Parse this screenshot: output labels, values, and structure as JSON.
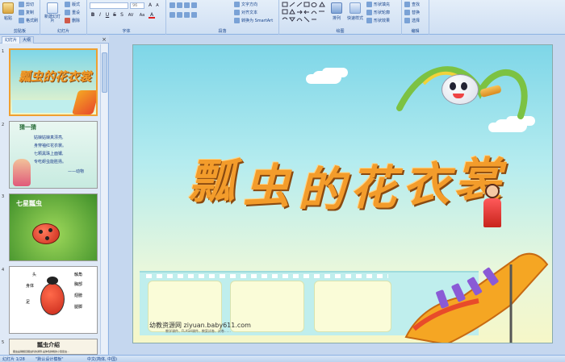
{
  "ribbon": {
    "clipboard": {
      "label": "剪贴板",
      "paste": "粘贴",
      "cut": "剪切",
      "copy": "复制",
      "format_painter": "格式刷"
    },
    "slides": {
      "label": "幻灯片",
      "new_slide": "新建幻灯片",
      "layout": "版式",
      "reset": "重设",
      "delete": "删除"
    },
    "font": {
      "label": "字体",
      "font_name": "",
      "font_size": "96",
      "bold": "B",
      "italic": "I",
      "underline": "U",
      "strike": "S",
      "shadow": "S",
      "spacing": "AV",
      "case": "Aa",
      "color": "A"
    },
    "paragraph": {
      "label": "段落",
      "text_direction": "文字方向",
      "align_text": "对齐文本",
      "smartart": "转换为 SmartArt"
    },
    "drawing": {
      "label": "绘图",
      "arrange": "排列",
      "quick_styles": "快速样式",
      "shape_fill": "形状填充",
      "shape_outline": "形状轮廓",
      "shape_effects": "形状效果"
    },
    "editing": {
      "label": "编辑",
      "find": "查找",
      "replace": "替换",
      "select": "选择"
    }
  },
  "left_pane": {
    "tab_slides": "幻灯片",
    "tab_outline": "大纲",
    "close": "×",
    "thumbs": [
      {
        "num": "1",
        "title": "瓢虫的花衣裳"
      },
      {
        "num": "2",
        "heading": "猜一猜",
        "lines": [
          "姑娘姑娘真漂亮,",
          "身穿袖红花衣裳。",
          "七颗黑珠上面镶,",
          "专吃蚜虫能胜扬。"
        ],
        "tail": "——动物"
      },
      {
        "num": "3",
        "heading": "七星瓢虫"
      },
      {
        "num": "4",
        "labels": [
          "头",
          "触角",
          "胸部",
          "身体",
          "翅膀",
          "腿脚",
          "足"
        ]
      },
      {
        "num": "5",
        "heading": "瓢虫介绍",
        "text": "瓢虫是鞘翅目瓢虫科的通称,是体色鲜艳的小型昆虫..."
      }
    ]
  },
  "slide": {
    "title_chars": [
      "瓢",
      "虫",
      "的",
      "花",
      "衣",
      "裳"
    ],
    "credit": "幼教资源网 ziyuan.baby611.com",
    "subcredit": "教学课件、FLASH课件、教案试卷、试卷……"
  },
  "statusbar": {
    "slide_info": "幻灯片 1/28",
    "theme": "\"默认设计模板\"",
    "language": "中文(简体, 中国)"
  },
  "colors": {
    "ribbon_bg": "#dbe7f6",
    "title_orange": "#f39c2b",
    "selection_orange": "#f0a030"
  }
}
